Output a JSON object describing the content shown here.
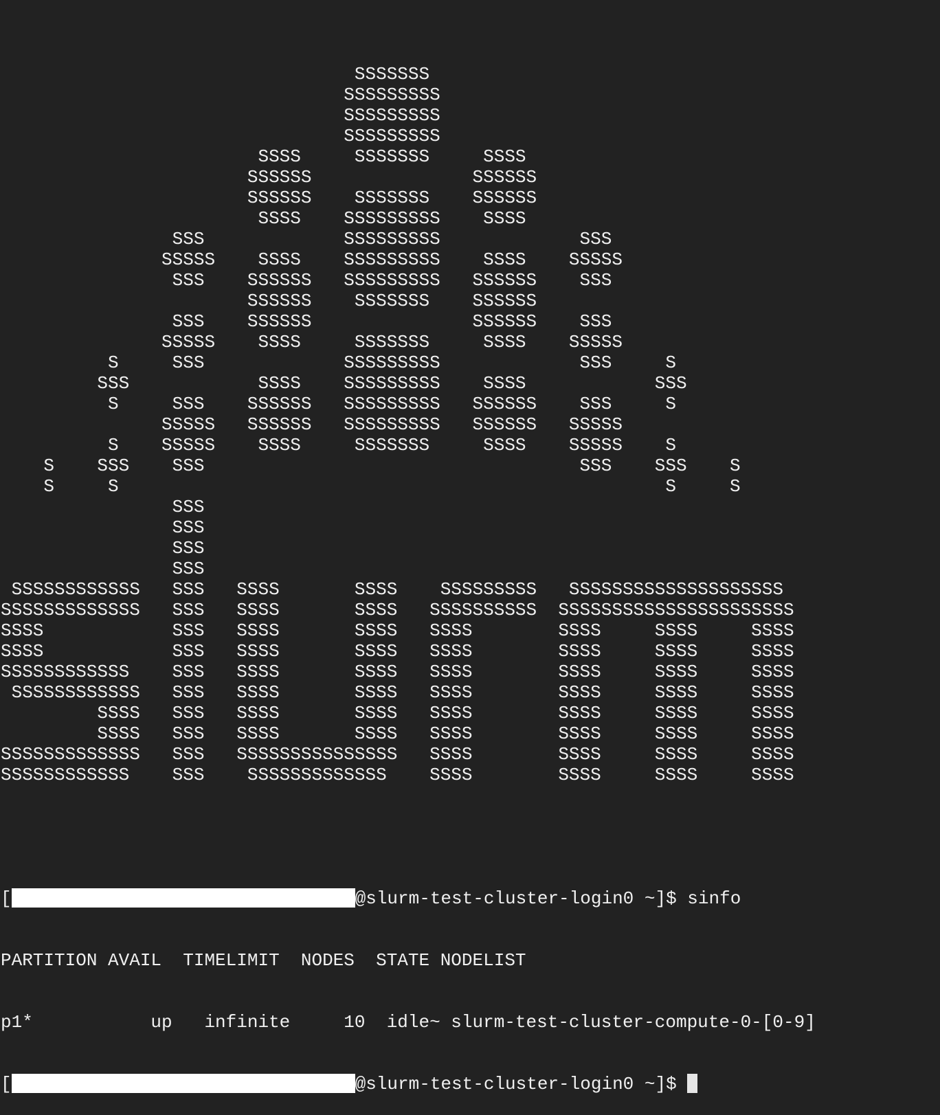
{
  "terminal": {
    "banner": [
      "                                 SSSSSSS",
      "                                SSSSSSSSS",
      "                                SSSSSSSSS",
      "                                SSSSSSSSS",
      "                        SSSS     SSSSSSS     SSSS",
      "                       SSSSSS               SSSSSS",
      "                       SSSSSS    SSSSSSS    SSSSSS",
      "                        SSSS    SSSSSSSSS    SSSS",
      "                SSS             SSSSSSSSS             SSS",
      "               SSSSS    SSSS    SSSSSSSSS    SSSS    SSSSS",
      "                SSS    SSSSSS   SSSSSSSSS   SSSSSS    SSS",
      "                       SSSSSS    SSSSSSS    SSSSSS",
      "                SSS    SSSSSS               SSSSSS    SSS",
      "               SSSSS    SSSS     SSSSSSS     SSSS    SSSSS",
      "          S     SSS             SSSSSSSSS             SSS     S",
      "         SSS            SSSS    SSSSSSSSS    SSSS            SSS",
      "          S     SSS    SSSSSS   SSSSSSSSS   SSSSSS    SSS     S",
      "               SSSSS   SSSSSS   SSSSSSSSS   SSSSSS   SSSSS",
      "          S    SSSSS    SSSS     SSSSSSS     SSSS    SSSSS    S",
      "    S    SSS    SSS                                   SSS    SSS    S",
      "    S     S                                                   S     S",
      "                SSS",
      "                SSS",
      "                SSS",
      "                SSS",
      " SSSSSSSSSSSS   SSS   SSSS       SSSS    SSSSSSSSS   SSSSSSSSSSSSSSSSSSSS",
      "SSSSSSSSSSSSS   SSS   SSSS       SSSS   SSSSSSSSSS  SSSSSSSSSSSSSSSSSSSSSS",
      "SSSS            SSS   SSSS       SSSS   SSSS        SSSS     SSSS     SSSS",
      "SSSS            SSS   SSSS       SSSS   SSSS        SSSS     SSSS     SSSS",
      "SSSSSSSSSSSS    SSS   SSSS       SSSS   SSSS        SSSS     SSSS     SSSS",
      " SSSSSSSSSSSS   SSS   SSSS       SSSS   SSSS        SSSS     SSSS     SSSS",
      "         SSSS   SSS   SSSS       SSSS   SSSS        SSSS     SSSS     SSSS",
      "         SSSS   SSS   SSSS       SSSS   SSSS        SSSS     SSSS     SSSS",
      "SSSSSSSSSSSSS   SSS   SSSSSSSSSSSSSSS   SSSS        SSSS     SSSS     SSSS",
      "SSSSSSSSSSSS    SSS    SSSSSSSSSSSSS    SSSS        SSSS     SSSS     SSSS"
    ],
    "prompt_open": "[",
    "prompt_host": "@slurm-test-cluster-login0 ~]$ ",
    "command": "sinfo",
    "output": [
      "PARTITION AVAIL  TIMELIMIT  NODES  STATE NODELIST",
      "p1*           up   infinite     10  idle~ slurm-test-cluster-compute-0-[0-9]"
    ]
  }
}
